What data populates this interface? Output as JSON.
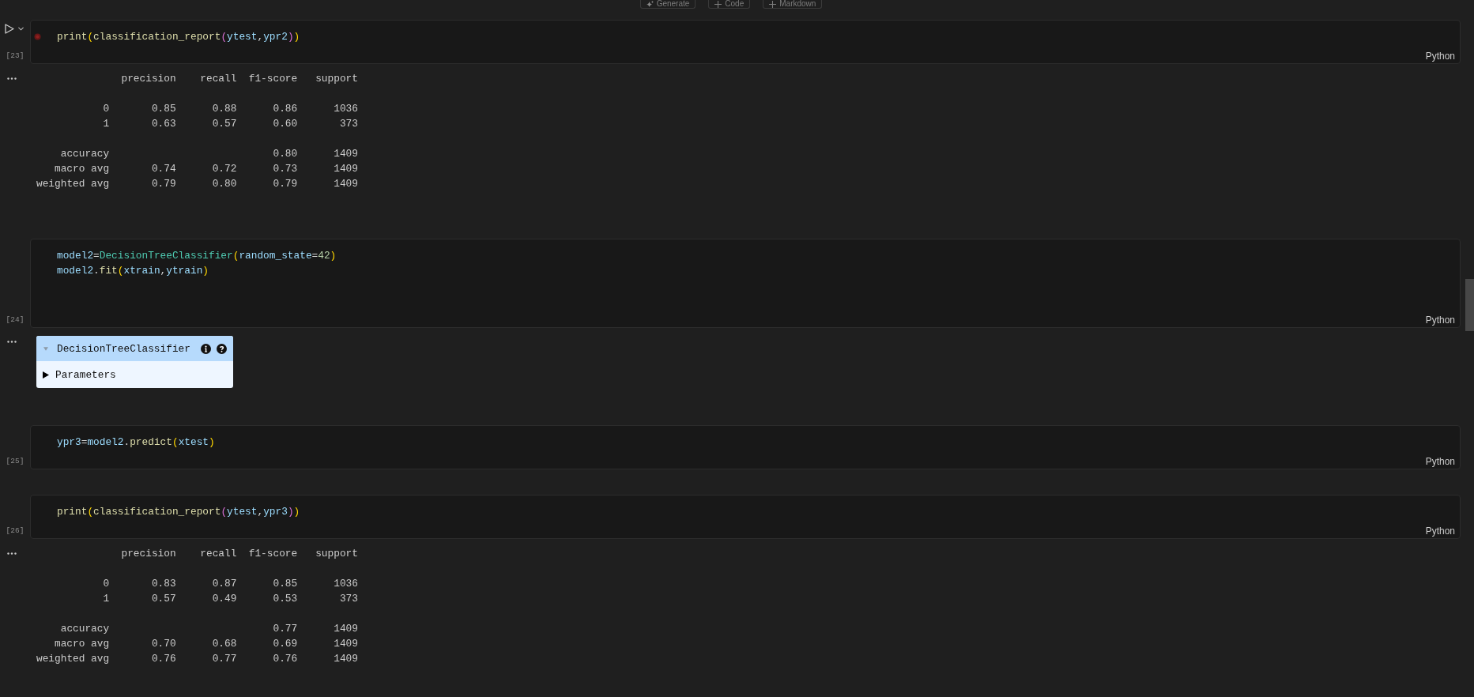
{
  "toolbar": [
    {
      "label": "Generate",
      "kind": "generate"
    },
    {
      "label": "Code",
      "kind": "add"
    },
    {
      "label": "Markdown",
      "kind": "add"
    }
  ],
  "cells": [
    {
      "execution_count": "[23]",
      "focused": true,
      "breakpoint": true,
      "language": "Python",
      "code": [
        [
          {
            "text": "print",
            "kind": "function"
          },
          {
            "text": "(",
            "kind": "bracket_outer"
          },
          {
            "text": "classification_report",
            "kind": "function"
          },
          {
            "text": "(",
            "kind": "bracket_inner"
          },
          {
            "text": "ytest",
            "kind": "variable"
          },
          {
            "text": ",",
            "kind": "operator"
          },
          {
            "text": "ypr2",
            "kind": "variable"
          },
          {
            "text": ")",
            "kind": "bracket_inner"
          },
          {
            "text": ")",
            "kind": "bracket_outer"
          }
        ]
      ],
      "output": {
        "kind": "report",
        "columns": [
          "precision",
          "recall",
          "f1-score",
          "support"
        ],
        "class_rows": [
          {
            "label": "0",
            "precision": "0.85",
            "recall": "0.88",
            "f1_score": "0.86",
            "support": "1036"
          },
          {
            "label": "1",
            "precision": "0.63",
            "recall": "0.57",
            "f1_score": "0.60",
            "support": "373"
          }
        ],
        "summary_rows": [
          {
            "label": "accuracy",
            "f1_score": "0.80",
            "support": "1409"
          },
          {
            "label": "macro avg",
            "precision": "0.74",
            "recall": "0.72",
            "f1_score": "0.73",
            "support": "1409"
          },
          {
            "label": "weighted avg",
            "precision": "0.79",
            "recall": "0.80",
            "f1_score": "0.79",
            "support": "1409"
          }
        ]
      }
    },
    {
      "execution_count": "[24]",
      "focused": false,
      "breakpoint": false,
      "language": "Python",
      "code": [
        [
          {
            "text": "model2",
            "kind": "variable"
          },
          {
            "text": "=",
            "kind": "operator"
          },
          {
            "text": "DecisionTreeClassifier",
            "kind": "class"
          },
          {
            "text": "(",
            "kind": "bracket_outer"
          },
          {
            "text": "random_state",
            "kind": "variable"
          },
          {
            "text": "=",
            "kind": "operator"
          },
          {
            "text": "42",
            "kind": "number"
          },
          {
            "text": ")",
            "kind": "bracket_outer"
          }
        ],
        [
          {
            "text": "model2",
            "kind": "variable"
          },
          {
            "text": ".",
            "kind": "operator"
          },
          {
            "text": "fit",
            "kind": "function"
          },
          {
            "text": "(",
            "kind": "bracket_outer"
          },
          {
            "text": "xtrain",
            "kind": "variable"
          },
          {
            "text": ",",
            "kind": "operator"
          },
          {
            "text": "ytrain",
            "kind": "variable"
          },
          {
            "text": ")",
            "kind": "bracket_outer"
          }
        ]
      ],
      "output": {
        "kind": "estimator",
        "name": "DecisionTreeClassifier",
        "parameters": {
          "label": "Parameters",
          "expanded": false
        }
      }
    },
    {
      "execution_count": "[25]",
      "focused": false,
      "breakpoint": false,
      "language": "Python",
      "code": [
        [
          {
            "text": "ypr3",
            "kind": "variable"
          },
          {
            "text": "=",
            "kind": "operator"
          },
          {
            "text": "model2",
            "kind": "variable"
          },
          {
            "text": ".",
            "kind": "operator"
          },
          {
            "text": "predict",
            "kind": "function"
          },
          {
            "text": "(",
            "kind": "bracket_outer"
          },
          {
            "text": "xtest",
            "kind": "variable"
          },
          {
            "text": ")",
            "kind": "bracket_outer"
          }
        ]
      ]
    },
    {
      "execution_count": "[26]",
      "focused": false,
      "breakpoint": false,
      "language": "Python",
      "code": [
        [
          {
            "text": "print",
            "kind": "function"
          },
          {
            "text": "(",
            "kind": "bracket_outer"
          },
          {
            "text": "classification_report",
            "kind": "function"
          },
          {
            "text": "(",
            "kind": "bracket_inner"
          },
          {
            "text": "ytest",
            "kind": "variable"
          },
          {
            "text": ",",
            "kind": "operator"
          },
          {
            "text": "ypr3",
            "kind": "variable"
          },
          {
            "text": ")",
            "kind": "bracket_inner"
          },
          {
            "text": ")",
            "kind": "bracket_outer"
          }
        ]
      ],
      "output": {
        "kind": "report",
        "columns": [
          "precision",
          "recall",
          "f1-score",
          "support"
        ],
        "class_rows": [
          {
            "label": "0",
            "precision": "0.83",
            "recall": "0.87",
            "f1_score": "0.85",
            "support": "1036"
          },
          {
            "label": "1",
            "precision": "0.57",
            "recall": "0.49",
            "f1_score": "0.53",
            "support": "373"
          }
        ],
        "summary_rows": [
          {
            "label": "accuracy",
            "f1_score": "0.77",
            "support": "1409"
          },
          {
            "label": "macro avg",
            "precision": "0.70",
            "recall": "0.68",
            "f1_score": "0.69",
            "support": "1409"
          },
          {
            "label": "weighted avg",
            "precision": "0.76",
            "recall": "0.77",
            "f1_score": "0.76",
            "support": "1409"
          }
        ]
      }
    }
  ]
}
